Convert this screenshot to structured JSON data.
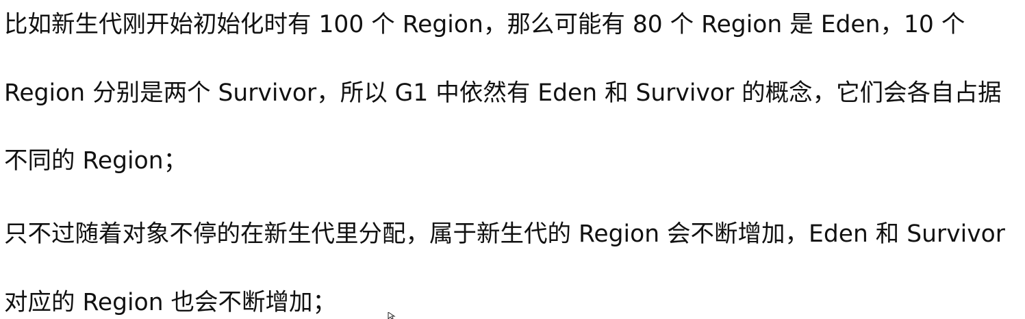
{
  "paragraphs": {
    "p1": {
      "line1": "比如新生代刚开始初始化时有 100 个 Region，那么可能有 80 个 Region 是 Eden，10 个",
      "line2": "Region 分别是两个 Survivor，所以 G1 中依然有 Eden 和 Survivor 的概念，它们会各自占据",
      "line3": "不同的 Region；"
    },
    "p2": {
      "line1": "只不过随着对象不停的在新生代里分配，属于新生代的 Region 会不断增加，Eden 和 Survivor",
      "line2": "对应的 Region 也会不断增加；"
    }
  },
  "cursor_icon": "mouse-pointer-icon"
}
